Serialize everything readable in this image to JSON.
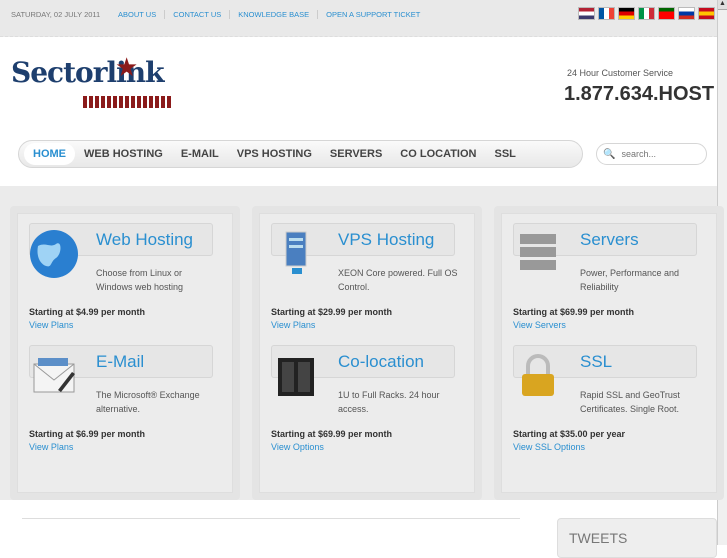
{
  "topbar": {
    "date": "SATURDAY, 02 JULY 2011",
    "links": [
      "ABOUT US",
      "CONTACT US",
      "KNOWLEDGE BASE",
      "OPEN A SUPPORT TICKET"
    ],
    "flags": [
      {
        "name": "english",
        "colors": [
          "#b22234",
          "#ffffff",
          "#3c3b6e"
        ]
      },
      {
        "name": "french",
        "colors": [
          "#0055a4",
          "#ffffff",
          "#ef4135"
        ]
      },
      {
        "name": "german",
        "colors": [
          "#000000",
          "#dd0000",
          "#ffce00"
        ]
      },
      {
        "name": "italian",
        "colors": [
          "#009246",
          "#ffffff",
          "#ce2b37"
        ]
      },
      {
        "name": "portuguese",
        "colors": [
          "#006600",
          "#ff0000",
          "#ff0000"
        ]
      },
      {
        "name": "russian",
        "colors": [
          "#ffffff",
          "#0039a6",
          "#d52b1e"
        ]
      },
      {
        "name": "spanish",
        "colors": [
          "#c60b1e",
          "#ffc400",
          "#c60b1e"
        ]
      }
    ]
  },
  "logo": {
    "text": "Sectorlink"
  },
  "header": {
    "service_label": "24 Hour Customer Service",
    "phone": "1.877.634.HOST"
  },
  "nav": {
    "items": [
      "HOME",
      "WEB HOSTING",
      "E-MAIL",
      "VPS HOSTING",
      "SERVERS",
      "CO LOCATION",
      "SSL"
    ],
    "active": "HOME"
  },
  "search": {
    "placeholder": "search..."
  },
  "services": [
    {
      "title": "Web Hosting",
      "desc": "Choose from Linux or Windows web hosting",
      "price": "Starting at $4.99 per month",
      "link": "View Plans",
      "icon": "globe"
    },
    {
      "title": "E-Mail",
      "desc": "The Microsoft® Exchange alternative.",
      "price": "Starting at $6.99 per month",
      "link": "View Plans",
      "icon": "email"
    },
    {
      "title": "VPS Hosting",
      "desc": "XEON Core powered. Full OS Control.",
      "price": "Starting at $29.99 per month",
      "link": "View Plans",
      "icon": "server"
    },
    {
      "title": "Co-location",
      "desc": "1U to Full Racks. 24 hour access.",
      "price": "Starting at $69.99 per month",
      "link": "View Options",
      "icon": "rack"
    },
    {
      "title": "Servers",
      "desc": "Power, Performance and Reliability",
      "price": "Starting at $69.99 per month",
      "link": "View Servers",
      "icon": "servers"
    },
    {
      "title": "SSL",
      "desc": "Rapid SSL and GeoTrust Certificates.  Single Root.",
      "price": "Starting at $35.00 per year",
      "link": "View SSL Options",
      "icon": "lock"
    }
  ],
  "tweets": {
    "title": "TWEETS"
  }
}
